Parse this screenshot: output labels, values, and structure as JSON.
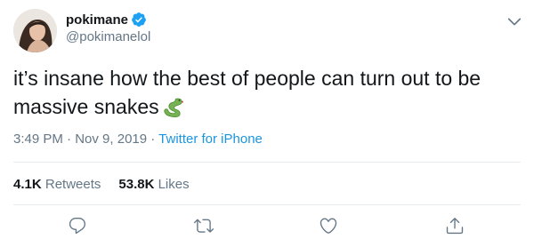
{
  "user": {
    "display_name": "pokimane",
    "handle": "@pokimanelol",
    "verified": true
  },
  "tweet": {
    "text": "it’s insane how the best of people can turn out to be massive snakes",
    "emoji": "snake-emoji"
  },
  "meta": {
    "time": "3:49 PM",
    "separator": " · ",
    "date": "Nov 9, 2019",
    "source": "Twitter for iPhone"
  },
  "stats": {
    "retweets_count": "4.1K",
    "retweets_label": "Retweets",
    "likes_count": "53.8K",
    "likes_label": "Likes"
  },
  "actions": [
    "reply-icon",
    "retweet-icon",
    "like-icon",
    "share-icon"
  ],
  "colors": {
    "text": "#14171a",
    "secondary": "#657786",
    "link": "#1b95e0",
    "verified": "#1da1f2",
    "divider": "#e6ecf0"
  }
}
